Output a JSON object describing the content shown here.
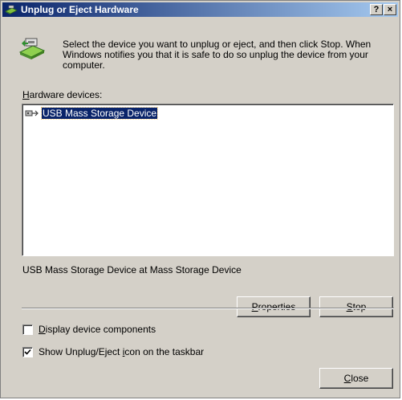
{
  "window": {
    "title": "Unplug or Eject Hardware",
    "help_button": "?",
    "close_button": "×"
  },
  "intro": {
    "text": "Select the device you want to unplug or eject, and then click Stop. When Windows notifies you that it is safe to do so unplug the device from your computer.",
    "icon": "unplug-hardware-icon"
  },
  "hardware_devices": {
    "label": "Hardware devices:",
    "items": [
      {
        "label": "USB Mass Storage Device",
        "icon": "usb-device-icon",
        "selected": true
      }
    ]
  },
  "device_description": "USB Mass Storage Device at Mass Storage Device",
  "buttons": {
    "properties": "Properties",
    "stop": "Stop",
    "close": "Close"
  },
  "options": {
    "display_components": {
      "label": "Display device components",
      "checked": false
    },
    "show_icon": {
      "label": "Show Unplug/Eject icon on the taskbar",
      "checked": true
    }
  },
  "colors": {
    "title_gradient_start": "#0a246a",
    "title_gradient_end": "#a6caf0",
    "dialog_bg": "#d4d0c8",
    "selection": "#0a246a"
  }
}
